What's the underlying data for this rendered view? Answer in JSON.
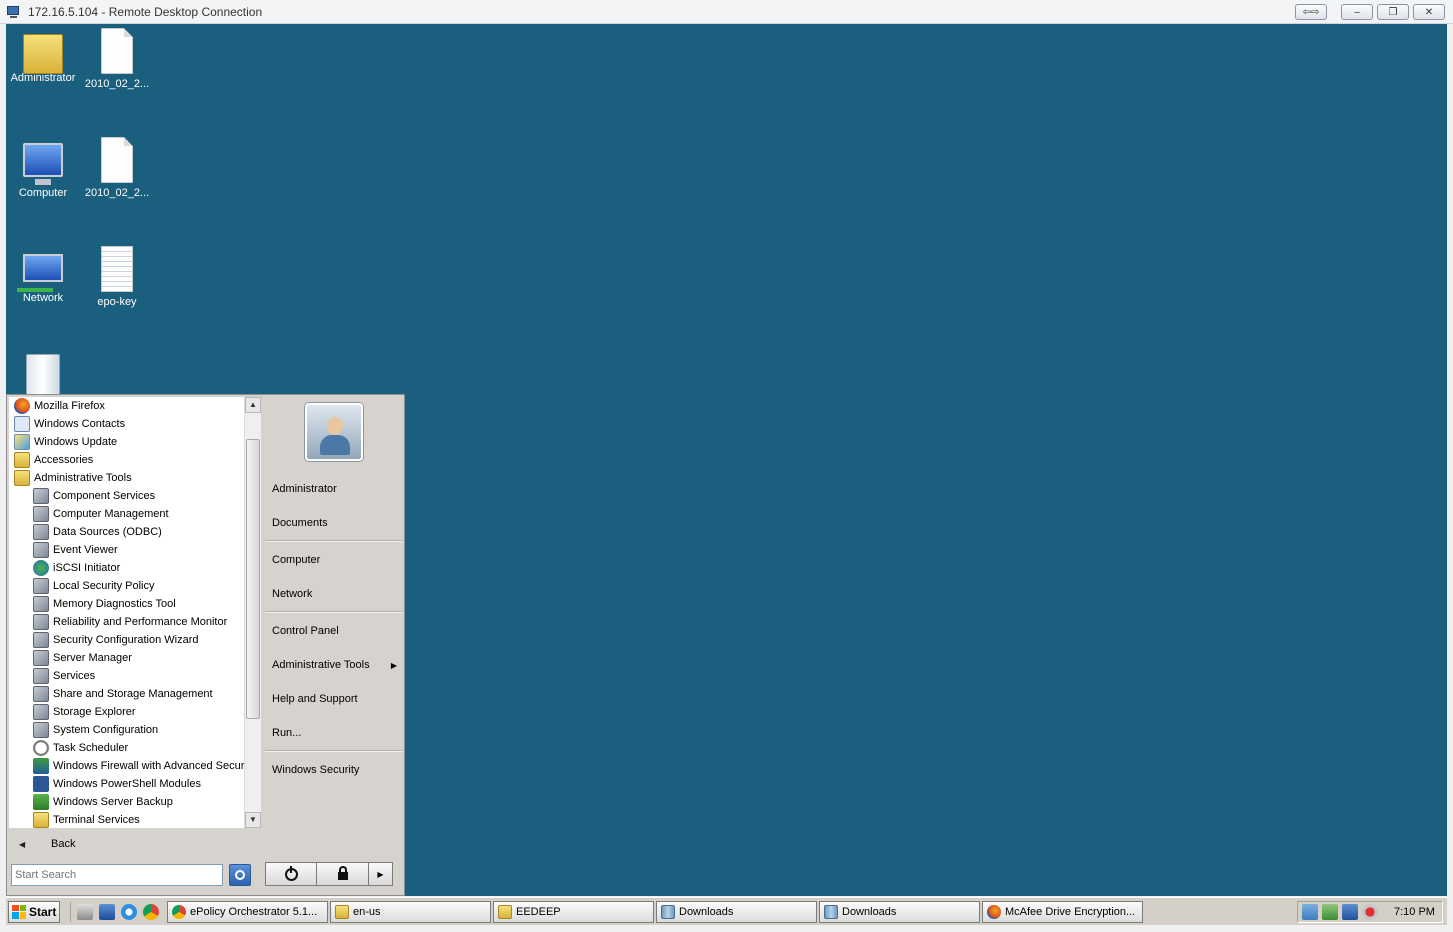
{
  "window": {
    "title": "172.16.5.104 - Remote Desktop Connection",
    "controls": {
      "connection_bar": "⇦⇨",
      "minimize": "–",
      "restore": "❐",
      "close": "✕"
    }
  },
  "desktop": {
    "background_color": "#1b5f7e",
    "icons": [
      {
        "label": "Administrator",
        "icon": "user-folder-icon"
      },
      {
        "label": "2010_02_2...",
        "icon": "file-icon"
      },
      {
        "label": "Computer",
        "icon": "computer-icon"
      },
      {
        "label": "2010_02_2...",
        "icon": "file-icon"
      },
      {
        "label": "Network",
        "icon": "network-icon"
      },
      {
        "label": "epo-key",
        "icon": "text-file-icon"
      },
      {
        "label": "",
        "icon": "recycle-bin-icon"
      }
    ]
  },
  "start_menu": {
    "programs": [
      {
        "label": "Mozilla Firefox",
        "icon": "firefox-icon"
      },
      {
        "label": "Windows Contacts",
        "icon": "contacts-icon"
      },
      {
        "label": "Windows Update",
        "icon": "windows-update-icon"
      },
      {
        "label": "Accessories",
        "icon": "folder-icon"
      },
      {
        "label": "Administrative Tools",
        "icon": "folder-icon"
      },
      {
        "label": "Component Services",
        "icon": "component-services-icon"
      },
      {
        "label": "Computer Management",
        "icon": "computer-management-icon"
      },
      {
        "label": "Data Sources (ODBC)",
        "icon": "odbc-icon"
      },
      {
        "label": "Event Viewer",
        "icon": "event-viewer-icon"
      },
      {
        "label": "iSCSI Initiator",
        "icon": "globe-icon"
      },
      {
        "label": "Local Security Policy",
        "icon": "security-policy-icon"
      },
      {
        "label": "Memory Diagnostics Tool",
        "icon": "memory-icon"
      },
      {
        "label": "Reliability and Performance Monitor",
        "icon": "performance-monitor-icon"
      },
      {
        "label": "Security Configuration Wizard",
        "icon": "security-wizard-icon"
      },
      {
        "label": "Server Manager",
        "icon": "server-manager-icon"
      },
      {
        "label": "Services",
        "icon": "services-icon"
      },
      {
        "label": "Share and Storage Management",
        "icon": "share-storage-icon"
      },
      {
        "label": "Storage Explorer",
        "icon": "storage-explorer-icon"
      },
      {
        "label": "System Configuration",
        "icon": "system-config-icon"
      },
      {
        "label": "Task Scheduler",
        "icon": "clock-icon"
      },
      {
        "label": "Windows Firewall with Advanced Securit",
        "icon": "firewall-icon"
      },
      {
        "label": "Windows PowerShell Modules",
        "icon": "powershell-icon"
      },
      {
        "label": "Windows Server Backup",
        "icon": "backup-icon"
      },
      {
        "label": "Terminal Services",
        "icon": "folder-icon"
      }
    ],
    "back_label": "Back",
    "search_placeholder": "Start Search",
    "right_items": {
      "administrator": "Administrator",
      "documents": "Documents",
      "computer": "Computer",
      "network": "Network",
      "control_panel": "Control Panel",
      "administrative_tools": "Administrative Tools",
      "help_and_support": "Help and Support",
      "run": "Run...",
      "windows_security": "Windows Security"
    }
  },
  "taskbar": {
    "start_label": "Start",
    "tasks": [
      {
        "label": "ePolicy Orchestrator 5.1...",
        "icon": "chrome-icon"
      },
      {
        "label": "en-us",
        "icon": "folder-icon"
      },
      {
        "label": "EEDEEP",
        "icon": "folder-icon"
      },
      {
        "label": "Downloads",
        "icon": "winrar-icon"
      },
      {
        "label": "Downloads",
        "icon": "winrar-icon"
      },
      {
        "label": "McAfee Drive Encryption...",
        "icon": "firefox-icon"
      }
    ],
    "clock": "7:10 PM"
  }
}
